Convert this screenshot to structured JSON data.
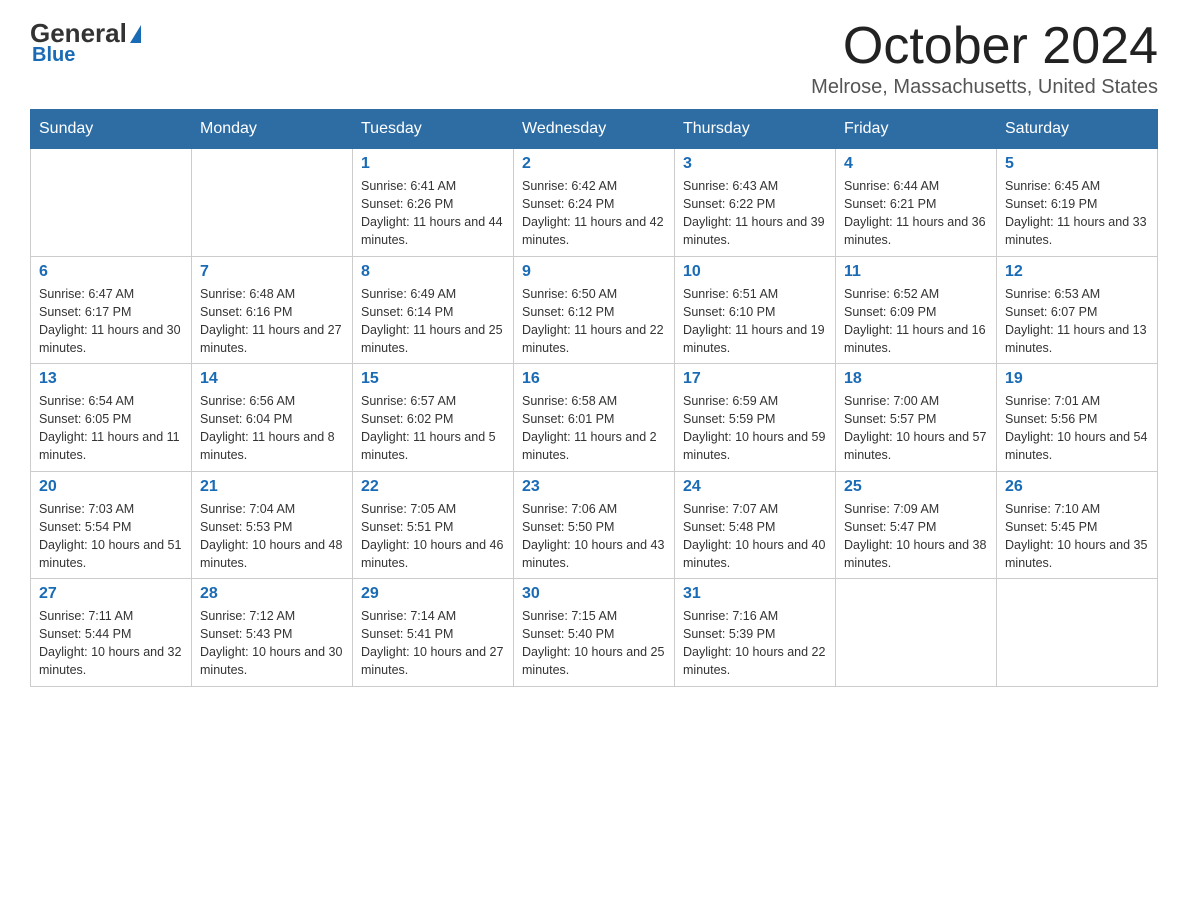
{
  "header": {
    "logo_general": "General",
    "logo_blue": "Blue",
    "month": "October 2024",
    "location": "Melrose, Massachusetts, United States"
  },
  "weekdays": [
    "Sunday",
    "Monday",
    "Tuesday",
    "Wednesday",
    "Thursday",
    "Friday",
    "Saturday"
  ],
  "weeks": [
    [
      {
        "day": "",
        "sunrise": "",
        "sunset": "",
        "daylight": ""
      },
      {
        "day": "",
        "sunrise": "",
        "sunset": "",
        "daylight": ""
      },
      {
        "day": "1",
        "sunrise": "Sunrise: 6:41 AM",
        "sunset": "Sunset: 6:26 PM",
        "daylight": "Daylight: 11 hours and 44 minutes."
      },
      {
        "day": "2",
        "sunrise": "Sunrise: 6:42 AM",
        "sunset": "Sunset: 6:24 PM",
        "daylight": "Daylight: 11 hours and 42 minutes."
      },
      {
        "day": "3",
        "sunrise": "Sunrise: 6:43 AM",
        "sunset": "Sunset: 6:22 PM",
        "daylight": "Daylight: 11 hours and 39 minutes."
      },
      {
        "day": "4",
        "sunrise": "Sunrise: 6:44 AM",
        "sunset": "Sunset: 6:21 PM",
        "daylight": "Daylight: 11 hours and 36 minutes."
      },
      {
        "day": "5",
        "sunrise": "Sunrise: 6:45 AM",
        "sunset": "Sunset: 6:19 PM",
        "daylight": "Daylight: 11 hours and 33 minutes."
      }
    ],
    [
      {
        "day": "6",
        "sunrise": "Sunrise: 6:47 AM",
        "sunset": "Sunset: 6:17 PM",
        "daylight": "Daylight: 11 hours and 30 minutes."
      },
      {
        "day": "7",
        "sunrise": "Sunrise: 6:48 AM",
        "sunset": "Sunset: 6:16 PM",
        "daylight": "Daylight: 11 hours and 27 minutes."
      },
      {
        "day": "8",
        "sunrise": "Sunrise: 6:49 AM",
        "sunset": "Sunset: 6:14 PM",
        "daylight": "Daylight: 11 hours and 25 minutes."
      },
      {
        "day": "9",
        "sunrise": "Sunrise: 6:50 AM",
        "sunset": "Sunset: 6:12 PM",
        "daylight": "Daylight: 11 hours and 22 minutes."
      },
      {
        "day": "10",
        "sunrise": "Sunrise: 6:51 AM",
        "sunset": "Sunset: 6:10 PM",
        "daylight": "Daylight: 11 hours and 19 minutes."
      },
      {
        "day": "11",
        "sunrise": "Sunrise: 6:52 AM",
        "sunset": "Sunset: 6:09 PM",
        "daylight": "Daylight: 11 hours and 16 minutes."
      },
      {
        "day": "12",
        "sunrise": "Sunrise: 6:53 AM",
        "sunset": "Sunset: 6:07 PM",
        "daylight": "Daylight: 11 hours and 13 minutes."
      }
    ],
    [
      {
        "day": "13",
        "sunrise": "Sunrise: 6:54 AM",
        "sunset": "Sunset: 6:05 PM",
        "daylight": "Daylight: 11 hours and 11 minutes."
      },
      {
        "day": "14",
        "sunrise": "Sunrise: 6:56 AM",
        "sunset": "Sunset: 6:04 PM",
        "daylight": "Daylight: 11 hours and 8 minutes."
      },
      {
        "day": "15",
        "sunrise": "Sunrise: 6:57 AM",
        "sunset": "Sunset: 6:02 PM",
        "daylight": "Daylight: 11 hours and 5 minutes."
      },
      {
        "day": "16",
        "sunrise": "Sunrise: 6:58 AM",
        "sunset": "Sunset: 6:01 PM",
        "daylight": "Daylight: 11 hours and 2 minutes."
      },
      {
        "day": "17",
        "sunrise": "Sunrise: 6:59 AM",
        "sunset": "Sunset: 5:59 PM",
        "daylight": "Daylight: 10 hours and 59 minutes."
      },
      {
        "day": "18",
        "sunrise": "Sunrise: 7:00 AM",
        "sunset": "Sunset: 5:57 PM",
        "daylight": "Daylight: 10 hours and 57 minutes."
      },
      {
        "day": "19",
        "sunrise": "Sunrise: 7:01 AM",
        "sunset": "Sunset: 5:56 PM",
        "daylight": "Daylight: 10 hours and 54 minutes."
      }
    ],
    [
      {
        "day": "20",
        "sunrise": "Sunrise: 7:03 AM",
        "sunset": "Sunset: 5:54 PM",
        "daylight": "Daylight: 10 hours and 51 minutes."
      },
      {
        "day": "21",
        "sunrise": "Sunrise: 7:04 AM",
        "sunset": "Sunset: 5:53 PM",
        "daylight": "Daylight: 10 hours and 48 minutes."
      },
      {
        "day": "22",
        "sunrise": "Sunrise: 7:05 AM",
        "sunset": "Sunset: 5:51 PM",
        "daylight": "Daylight: 10 hours and 46 minutes."
      },
      {
        "day": "23",
        "sunrise": "Sunrise: 7:06 AM",
        "sunset": "Sunset: 5:50 PM",
        "daylight": "Daylight: 10 hours and 43 minutes."
      },
      {
        "day": "24",
        "sunrise": "Sunrise: 7:07 AM",
        "sunset": "Sunset: 5:48 PM",
        "daylight": "Daylight: 10 hours and 40 minutes."
      },
      {
        "day": "25",
        "sunrise": "Sunrise: 7:09 AM",
        "sunset": "Sunset: 5:47 PM",
        "daylight": "Daylight: 10 hours and 38 minutes."
      },
      {
        "day": "26",
        "sunrise": "Sunrise: 7:10 AM",
        "sunset": "Sunset: 5:45 PM",
        "daylight": "Daylight: 10 hours and 35 minutes."
      }
    ],
    [
      {
        "day": "27",
        "sunrise": "Sunrise: 7:11 AM",
        "sunset": "Sunset: 5:44 PM",
        "daylight": "Daylight: 10 hours and 32 minutes."
      },
      {
        "day": "28",
        "sunrise": "Sunrise: 7:12 AM",
        "sunset": "Sunset: 5:43 PM",
        "daylight": "Daylight: 10 hours and 30 minutes."
      },
      {
        "day": "29",
        "sunrise": "Sunrise: 7:14 AM",
        "sunset": "Sunset: 5:41 PM",
        "daylight": "Daylight: 10 hours and 27 minutes."
      },
      {
        "day": "30",
        "sunrise": "Sunrise: 7:15 AM",
        "sunset": "Sunset: 5:40 PM",
        "daylight": "Daylight: 10 hours and 25 minutes."
      },
      {
        "day": "31",
        "sunrise": "Sunrise: 7:16 AM",
        "sunset": "Sunset: 5:39 PM",
        "daylight": "Daylight: 10 hours and 22 minutes."
      },
      {
        "day": "",
        "sunrise": "",
        "sunset": "",
        "daylight": ""
      },
      {
        "day": "",
        "sunrise": "",
        "sunset": "",
        "daylight": ""
      }
    ]
  ]
}
